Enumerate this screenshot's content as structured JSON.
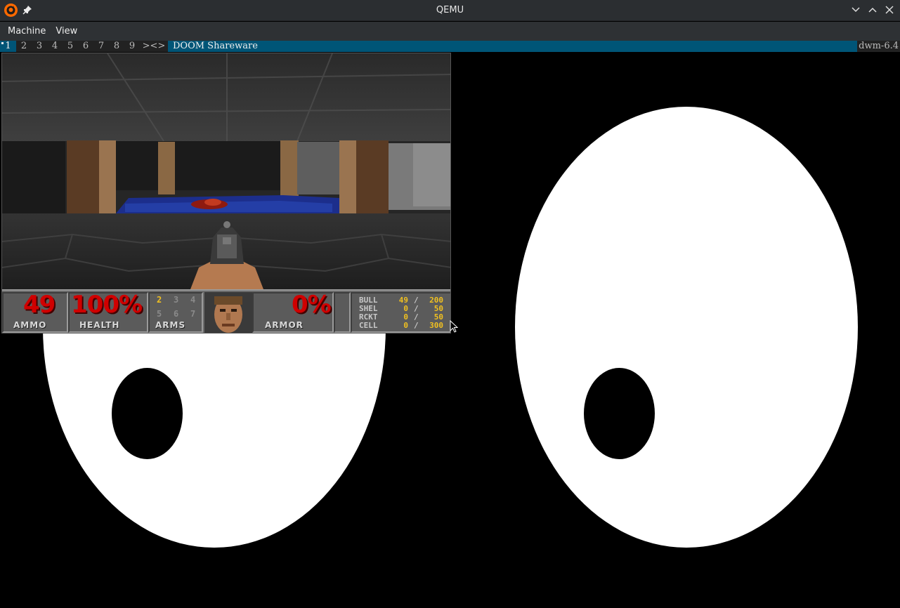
{
  "window": {
    "title": "QEMU",
    "app_icon": "qemu-logo-icon",
    "pin_icon": "pin-icon",
    "controls": [
      "minimize-chevron-icon",
      "maximize-chevron-icon",
      "close-icon"
    ]
  },
  "menubar": {
    "items": [
      "Machine",
      "View"
    ]
  },
  "dwm": {
    "tags": [
      "1",
      "2",
      "3",
      "4",
      "5",
      "6",
      "7",
      "8",
      "9"
    ],
    "selected_tag": "1",
    "layout_symbol": "><>",
    "window_title": "DOOM Shareware",
    "status": "dwm-6.4",
    "colors": {
      "bar_bg": "#222222",
      "selected_bg": "#005577",
      "fg": "#bbbbbb",
      "sel_fg": "#eeeeee"
    }
  },
  "doom": {
    "hud": {
      "ammo_value": "49",
      "ammo_label": "AMMO",
      "health_value": "100%",
      "health_label": "HEALTH",
      "arms_label": "ARMS",
      "arms_slots": [
        "2",
        "3",
        "4",
        "5",
        "6",
        "7"
      ],
      "armor_value": "0%",
      "armor_label": "ARMOR",
      "ammo_table": [
        {
          "name": "BULL",
          "current": "49",
          "max": "200"
        },
        {
          "name": "SHEL",
          "current": "0",
          "max": "50"
        },
        {
          "name": "RCKT",
          "current": "0",
          "max": "50"
        },
        {
          "name": "CELL",
          "current": "0",
          "max": "300"
        }
      ],
      "separator": "/"
    }
  }
}
